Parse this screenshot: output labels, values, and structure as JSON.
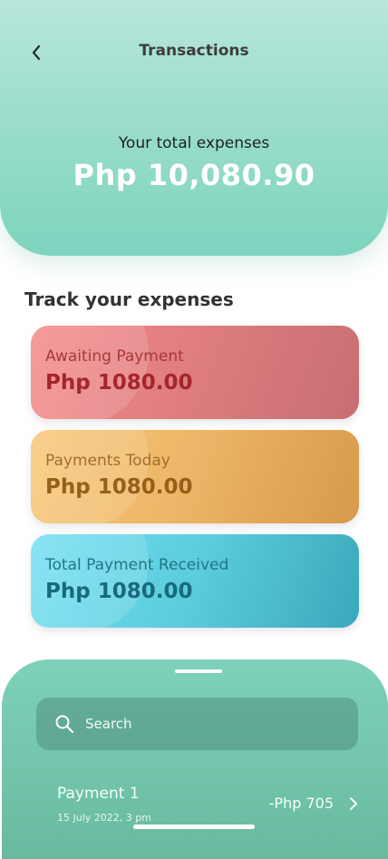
{
  "header": {
    "title": "Transactions",
    "total_label": "Your total expenses",
    "total_value": "Php 10,080.90"
  },
  "section": {
    "title": "Track your expenses"
  },
  "cards": [
    {
      "label": "Awaiting Payment",
      "amount": "Php 1080.00",
      "color": "#f28a8c"
    },
    {
      "label": "Payments Today",
      "amount": "Php 1080.00",
      "color": "#f2c06e"
    },
    {
      "label": "Total Payment Received",
      "amount": "Php 1080.00",
      "color": "#63d6e8"
    }
  ],
  "bottom_sheet": {
    "search": {
      "placeholder": "Search"
    },
    "transactions": [
      {
        "name": "Payment 1",
        "date": "15 July 2022, 3 pm",
        "amount": "-Php 705"
      }
    ]
  },
  "colors": {
    "header_mint": "#96dcc8",
    "sheet_green": "#71c3aa",
    "white": "#ffffff"
  },
  "icons": [
    "back-arrow-icon",
    "search-icon",
    "chevron-right-icon"
  ]
}
